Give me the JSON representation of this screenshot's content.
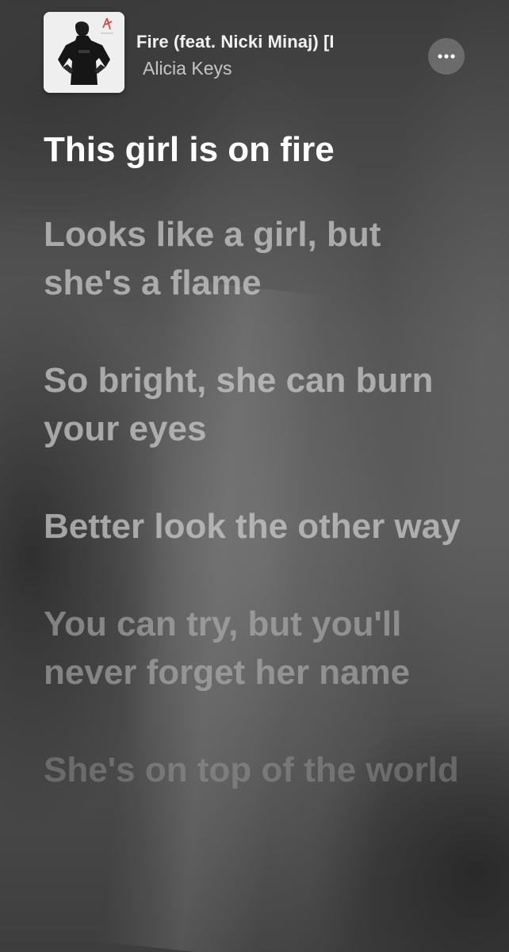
{
  "now_playing": {
    "title": "Fire (feat. Nicki Minaj) [I",
    "artist": "Alicia Keys",
    "more_icon": "ellipsis-icon",
    "album_art_icon": "album-cover"
  },
  "lyrics": {
    "lines": [
      "This girl is on fire",
      "Looks like a girl, but she's a flame",
      "So bright, she can burn your eyes",
      "Better look the other way",
      "You can try, but you'll never forget her name",
      "She's on top of the world"
    ]
  },
  "colors": {
    "active_lyric": "#ffffff",
    "inactive_lyric": "#cdcdcd",
    "more_button_bg": "#787878"
  }
}
